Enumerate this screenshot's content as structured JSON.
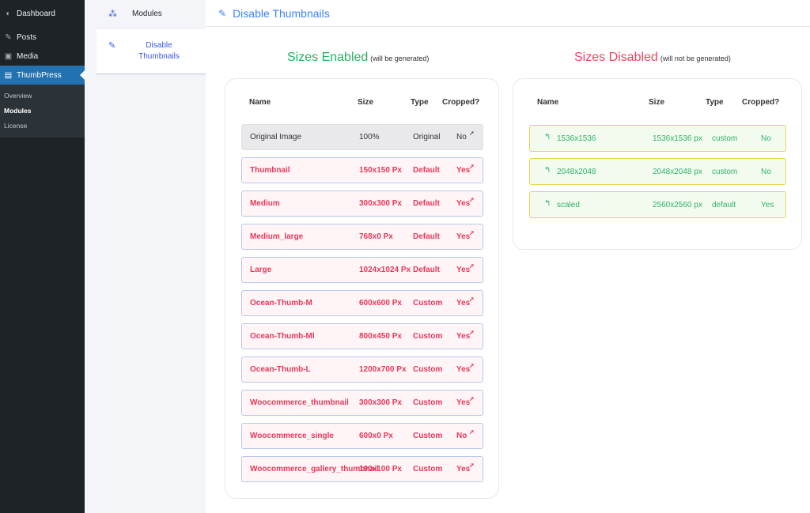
{
  "wp_sidebar": {
    "items": [
      {
        "label": "Dashboard",
        "icon": "dashboard-icon"
      },
      {
        "label": "Posts",
        "icon": "pin-icon"
      },
      {
        "label": "Media",
        "icon": "media-icon"
      },
      {
        "label": "ThumbPress",
        "icon": "thumbpress-icon"
      }
    ],
    "submenu": [
      {
        "label": "Overview"
      },
      {
        "label": "Modules"
      },
      {
        "label": "License"
      }
    ]
  },
  "plugin_nav": {
    "items": [
      {
        "label": "Modules",
        "icon": "modules-icon"
      },
      {
        "label": "Disable Thumbnails",
        "icon": "pencil-icon"
      }
    ]
  },
  "header": {
    "title": "Disable Thumbnails"
  },
  "enabled": {
    "title": "Sizes Enabled",
    "subtitle": "(will be generated)",
    "columns": [
      "Name",
      "Size",
      "Type",
      "Cropped?"
    ],
    "rows": [
      {
        "name": "Original Image",
        "size": "100%",
        "type": "Original",
        "cropped": "No"
      },
      {
        "name": "Thumbnail",
        "size": "150x150 Px",
        "type": "Default",
        "cropped": "Yes"
      },
      {
        "name": "Medium",
        "size": "300x300 Px",
        "type": "Default",
        "cropped": "Yes"
      },
      {
        "name": "Medium_large",
        "size": "768x0 Px",
        "type": "Default",
        "cropped": "Yes"
      },
      {
        "name": "Large",
        "size": "1024x1024 Px",
        "type": "Default",
        "cropped": "Yes"
      },
      {
        "name": "Ocean-Thumb-M",
        "size": "600x600 Px",
        "type": "Custom",
        "cropped": "Yes"
      },
      {
        "name": "Ocean-Thumb-Ml",
        "size": "800x450 Px",
        "type": "Custom",
        "cropped": "Yes"
      },
      {
        "name": "Ocean-Thumb-L",
        "size": "1200x700 Px",
        "type": "Custom",
        "cropped": "Yes"
      },
      {
        "name": "Woocommerce_thumbnail",
        "size": "300x300 Px",
        "type": "Custom",
        "cropped": "Yes"
      },
      {
        "name": "Woocommerce_single",
        "size": "600x0 Px",
        "type": "Custom",
        "cropped": "No"
      },
      {
        "name": "Woocommerce_gallery_thumbnail",
        "size": "100x100 Px",
        "type": "Custom",
        "cropped": "Yes"
      }
    ]
  },
  "disabled": {
    "title": "Sizes Disabled",
    "subtitle": "(will not be generated)",
    "columns": [
      "Name",
      "Size",
      "Type",
      "Cropped?"
    ],
    "rows": [
      {
        "name": "1536x1536",
        "size": "1536x1536 px",
        "type": "custom",
        "cropped": "No"
      },
      {
        "name": "2048x2048",
        "size": "2048x2048 px",
        "type": "custom",
        "cropped": "No"
      },
      {
        "name": "scaled",
        "size": "2560x2560 px",
        "type": "default",
        "cropped": "Yes"
      }
    ]
  },
  "colors": {
    "enabled_title": "#22b35e",
    "disabled_title": "#f43f5e",
    "enabled_row_text": "#e8375a",
    "disabled_row_text": "#2fb36a",
    "accent": "#3b82f6",
    "wp_active": "#2271b1"
  }
}
